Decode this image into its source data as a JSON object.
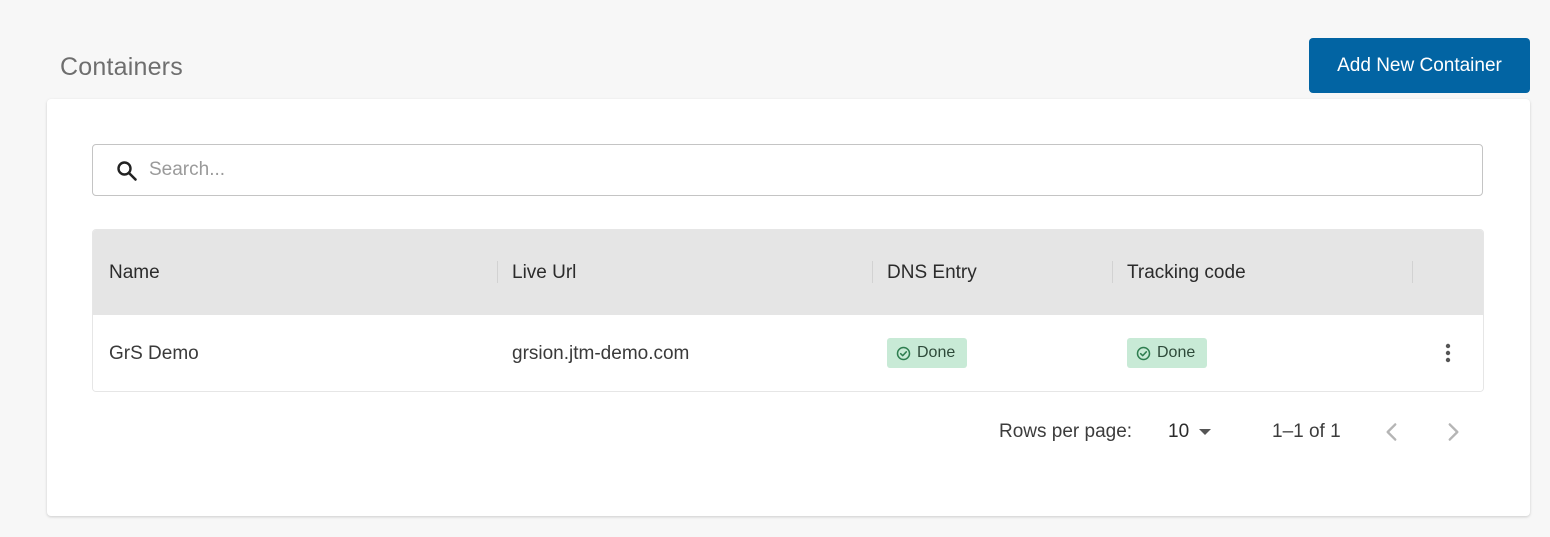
{
  "page": {
    "title": "Containers",
    "add_button_label": "Add New Container"
  },
  "search": {
    "placeholder": "Search...",
    "value": "",
    "icon": "search-icon"
  },
  "table": {
    "columns": [
      "Name",
      "Live Url",
      "DNS Entry",
      "Tracking code"
    ],
    "rows": [
      {
        "name": "GrS Demo",
        "live_url": "grsion.jtm-demo.com",
        "dns_entry": "Done",
        "tracking_code": "Done",
        "actions_icon": "more-vert-icon"
      }
    ]
  },
  "pagination": {
    "rows_per_page_label": "Rows per page:",
    "rows_per_page_value": "10",
    "range_label": "1–1 of 1",
    "prev_icon": "chevron-left-icon",
    "next_icon": "chevron-right-icon"
  },
  "colors": {
    "primary_button": "#0264a3",
    "status_done_bg": "#c8ead6",
    "status_done_icon": "#2e7d4f",
    "header_bg": "#e5e5e5",
    "page_bg": "#f7f7f7"
  }
}
